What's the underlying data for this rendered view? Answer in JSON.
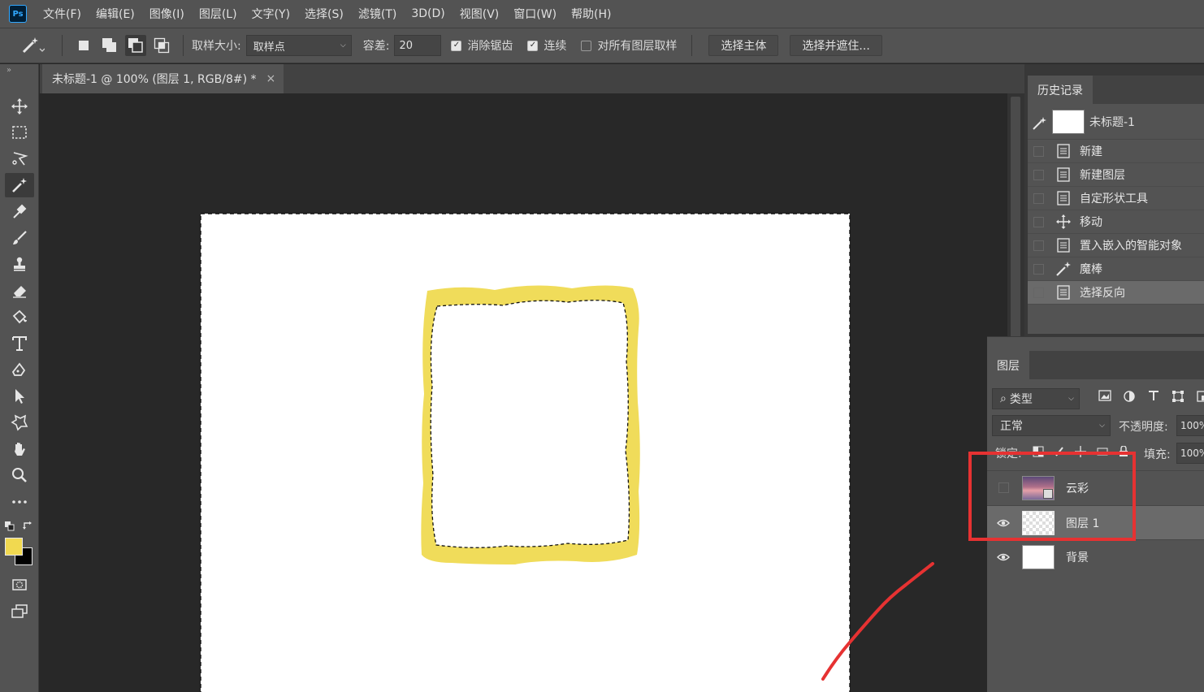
{
  "app": {
    "logo": "Ps"
  },
  "menu": [
    "文件(F)",
    "编辑(E)",
    "图像(I)",
    "图层(L)",
    "文字(Y)",
    "选择(S)",
    "滤镜(T)",
    "3D(D)",
    "视图(V)",
    "窗口(W)",
    "帮助(H)"
  ],
  "options": {
    "sample_size_label": "取样大小:",
    "sample_size_value": "取样点",
    "tolerance_label": "容差:",
    "tolerance_value": "20",
    "antialias_label": "消除锯齿",
    "antialias_checked": true,
    "contiguous_label": "连续",
    "contiguous_checked": true,
    "all_layers_label": "对所有图层取样",
    "all_layers_checked": false,
    "select_subject_label": "选择主体",
    "select_mask_label": "选择并遮住..."
  },
  "document": {
    "tab_title": "未标题-1 @ 100% (图层 1, RGB/8#) *",
    "close_symbol": "×"
  },
  "colors": {
    "foreground": "#f1d950",
    "background": "#000000",
    "frame": "#f0dc5a",
    "annotation": "#e63232"
  },
  "history": {
    "panel_title": "历史记录",
    "snapshot_label": "未标题-1",
    "items": [
      {
        "label": "新建",
        "icon": "document-icon"
      },
      {
        "label": "新建图层",
        "icon": "document-icon"
      },
      {
        "label": "自定形状工具",
        "icon": "document-icon"
      },
      {
        "label": "移动",
        "icon": "move-icon"
      },
      {
        "label": "置入嵌入的智能对象",
        "icon": "document-icon"
      },
      {
        "label": "魔棒",
        "icon": "magic-wand-icon"
      },
      {
        "label": "选择反向",
        "icon": "document-icon",
        "selected": true
      }
    ]
  },
  "layers": {
    "panel_title": "图层",
    "filter_value": "类型",
    "blend_mode": "正常",
    "opacity_label": "不透明度:",
    "opacity_value": "100%",
    "lock_label": "锁定:",
    "fill_label": "填充:",
    "fill_value": "100%",
    "items": [
      {
        "name": "云彩",
        "visible": false,
        "thumb": "clouds"
      },
      {
        "name": "图层 1",
        "visible": true,
        "thumb": "transparent",
        "selected": true
      },
      {
        "name": "背景",
        "visible": true,
        "thumb": "white"
      }
    ]
  }
}
